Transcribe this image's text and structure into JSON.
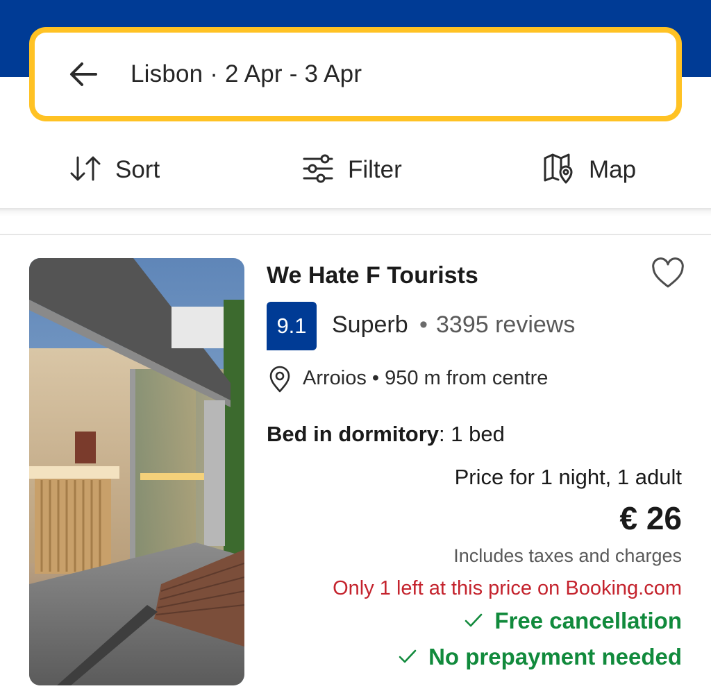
{
  "search": {
    "summary": "Lisbon · 2 Apr - 3 Apr"
  },
  "toolbar": {
    "sort_label": "Sort",
    "filter_label": "Filter",
    "map_label": "Map"
  },
  "property": {
    "name": "We Hate F Tourists",
    "score": "9.1",
    "score_word": "Superb",
    "separator": "•",
    "reviews": "3395 reviews",
    "location": "Arroios • 950 m from centre",
    "room_type": "Bed in dormitory",
    "room_beds": ": 1 bed",
    "price_for": "Price for 1 night, 1 adult",
    "price": "€ 26",
    "taxes_note": "Includes taxes and charges",
    "scarcity_note": "Only 1 left at this price on Booking.com",
    "perks": [
      "Free cancellation",
      "No prepayment needed"
    ]
  },
  "colors": {
    "brand_blue": "#003b95",
    "search_border": "#ffc224",
    "perk_green": "#118a3c",
    "scarcity_red": "#c4232d"
  },
  "icons": [
    "back-arrow-icon",
    "sort-icon",
    "filter-icon",
    "map-icon",
    "heart-icon",
    "location-pin-icon",
    "check-icon"
  ]
}
